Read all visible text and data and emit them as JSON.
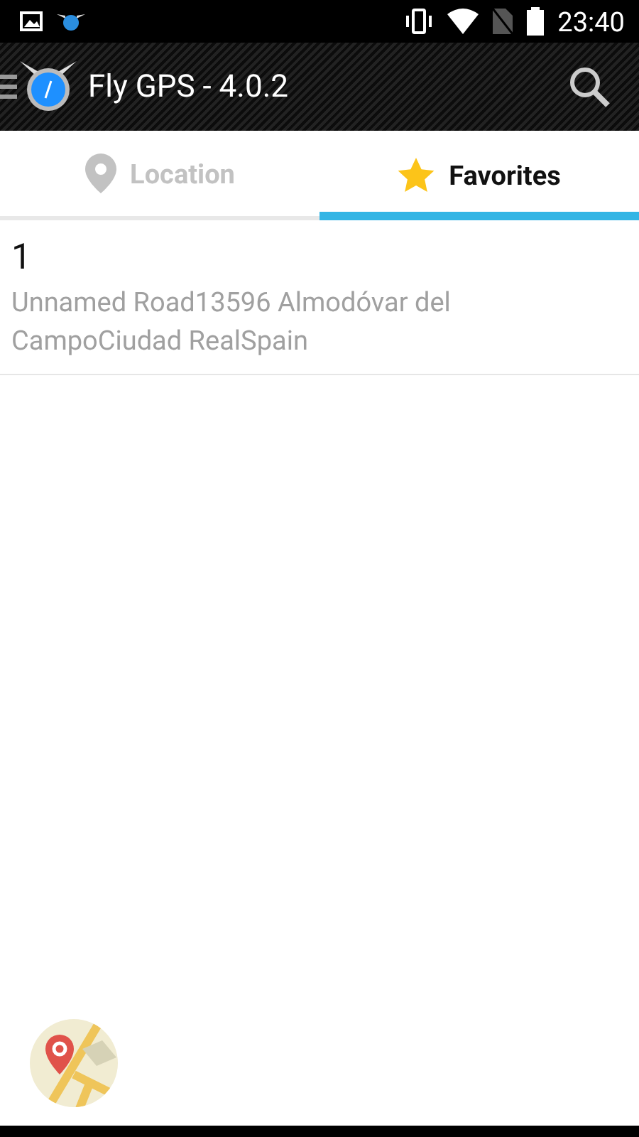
{
  "status_bar": {
    "time": "23:40"
  },
  "app_bar": {
    "title": "Fly GPS - 4.0.2"
  },
  "tabs": [
    {
      "label": "Location",
      "kind": "pin",
      "selected": false
    },
    {
      "label": "Favorites",
      "kind": "star",
      "selected": true
    }
  ],
  "favorites": [
    {
      "title": "1",
      "address": "Unnamed Road13596 Almodóvar del CampoCiudad RealSpain"
    }
  ]
}
